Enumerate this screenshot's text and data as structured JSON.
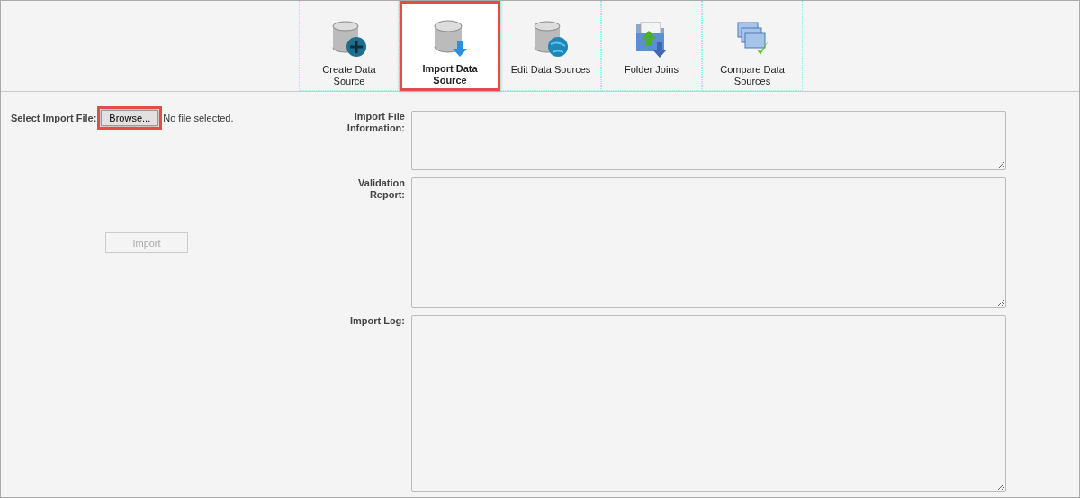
{
  "toolbar": [
    {
      "kind": "create",
      "label": "Create Data Source",
      "selected": false
    },
    {
      "kind": "import",
      "label": "Import Data Source",
      "selected": true
    },
    {
      "kind": "edit",
      "label": "Edit Data Sources",
      "selected": false
    },
    {
      "kind": "joins",
      "label": "Folder Joins",
      "selected": false
    },
    {
      "kind": "compare",
      "label": "Compare Data Sources",
      "selected": false
    }
  ],
  "file_picker": {
    "label": "Select Import File:",
    "button": "Browse...",
    "highlighted": true,
    "status": "No file selected."
  },
  "import_button": {
    "label": "Import",
    "disabled": true
  },
  "fields": [
    {
      "label": "Import File Information:"
    },
    {
      "label": "Validation Report:"
    },
    {
      "label": "Import Log:"
    }
  ]
}
